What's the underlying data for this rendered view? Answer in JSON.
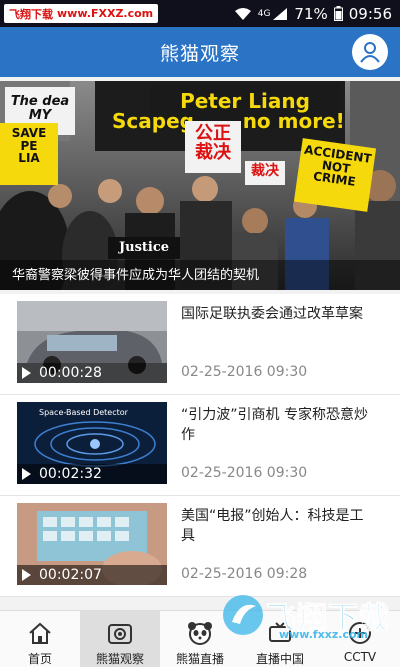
{
  "status_bar": {
    "watermark_cn": "飞翔下载",
    "watermark_url": "www.FXXZ.com",
    "network": "4G",
    "battery": "71%",
    "time": "09:56"
  },
  "header": {
    "title": "熊猫观察"
  },
  "banner": {
    "caption": "华裔警察梁彼得事件应成为华人团结的契机",
    "signs": {
      "peter_liang": "Peter Liang",
      "scapegoat": "Scapeg       no more!",
      "justice_cn": "公正\n裁决",
      "accident": "ACCIDENT\nNOT\nCRIME",
      "save_liang": "SAVE\nPE\nLIA",
      "the_dead": "The dea\nMY",
      "justice_en": "Justice",
      "justice_cn_small": "裁决"
    }
  },
  "news": [
    {
      "title": "国际足联执委会通过改革草案",
      "time": "02-25-2016 09:30",
      "duration": "00:00:28"
    },
    {
      "title": "“引力波”引商机 专家称恐意炒作",
      "time": "02-25-2016 09:30",
      "duration": "00:02:32",
      "thumb_text": "Space-Based Detector"
    },
    {
      "title": "美国“电报”创始人：科技是工具",
      "time": "02-25-2016 09:28",
      "duration": "00:02:07"
    }
  ],
  "bottom_nav": [
    {
      "label": "首页"
    },
    {
      "label": "熊猫观察"
    },
    {
      "label": "熊猫直播"
    },
    {
      "label": "直播中国"
    },
    {
      "label": "CCTV"
    }
  ],
  "watermark_bottom": {
    "cn": "飞翔下载",
    "url": "www.fxxz.com"
  },
  "colors": {
    "header": "#2a73c5",
    "status_bar": "#10101c",
    "accent_sign": "#f5d90c"
  }
}
